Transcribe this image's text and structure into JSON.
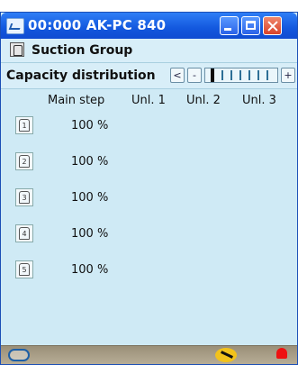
{
  "window": {
    "title": "00:000 AK-PC 840"
  },
  "header": {
    "group_label": "Suction Group",
    "capacity_label": "Capacity distribution"
  },
  "capacity_nav": {
    "first": "<",
    "prev": "-",
    "next": "+"
  },
  "table": {
    "headers": [
      "Main step",
      "Unl. 1",
      "Unl. 2",
      "Unl. 3"
    ],
    "rows": [
      {
        "step": "1",
        "value": "100 %"
      },
      {
        "step": "2",
        "value": "100 %"
      },
      {
        "step": "3",
        "value": "100 %"
      },
      {
        "step": "4",
        "value": "100 %"
      },
      {
        "step": "5",
        "value": "100 %"
      }
    ]
  },
  "icons": {
    "title": "app-icon",
    "group": "suction-group-icon",
    "step": "compressor-step-icon",
    "bottom_left": "users-icon",
    "bottom_mid": "wrench-icon",
    "bottom_right": "alarm-bell-icon"
  },
  "colors": {
    "title_bar": "#1358de",
    "background": "#cfeaf5",
    "close": "#d9432a",
    "alarm": "#e11111"
  }
}
